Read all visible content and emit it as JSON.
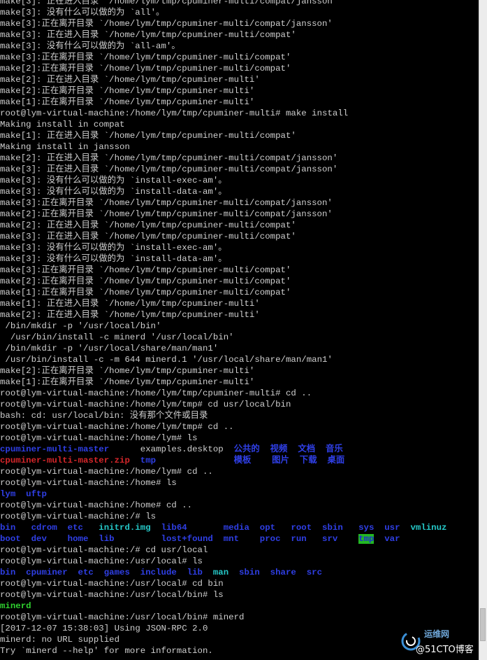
{
  "colors": {
    "background": "#000000",
    "text": "#cfcfcf",
    "directory": "#2f3fe6",
    "archive": "#d6262a",
    "executable": "#2fd12f",
    "symlink": "#25c8c8",
    "sticky_dir_bg": "#23b823"
  },
  "scrollbar": {
    "thumb_position": 0.97,
    "thumb_size": 0.05
  },
  "watermark": {
    "site": "运维网",
    "brand": "@51CTO博客",
    "logo_icon": "swirl-logo-icon"
  },
  "terminal": {
    "lines": [
      [
        {
          "t": "make[3]: 正在进入目录 `/home/lym/tmp/cpuminer-multi/compat/jansson'"
        }
      ],
      [
        {
          "t": "make[3]: 没有什么可以做的为 `all'。"
        }
      ],
      [
        {
          "t": "make[3]:正在离开目录 `/home/lym/tmp/cpuminer-multi/compat/jansson'"
        }
      ],
      [
        {
          "t": "make[3]: 正在进入目录 `/home/lym/tmp/cpuminer-multi/compat'"
        }
      ],
      [
        {
          "t": "make[3]: 没有什么可以做的为 `all-am'。"
        }
      ],
      [
        {
          "t": "make[3]:正在离开目录 `/home/lym/tmp/cpuminer-multi/compat'"
        }
      ],
      [
        {
          "t": "make[2]:正在离开目录 `/home/lym/tmp/cpuminer-multi/compat'"
        }
      ],
      [
        {
          "t": "make[2]: 正在进入目录 `/home/lym/tmp/cpuminer-multi'"
        }
      ],
      [
        {
          "t": "make[2]:正在离开目录 `/home/lym/tmp/cpuminer-multi'"
        }
      ],
      [
        {
          "t": "make[1]:正在离开目录 `/home/lym/tmp/cpuminer-multi'"
        }
      ],
      [
        {
          "t": "root@lym-virtual-machine:/home/lym/tmp/cpuminer-multi# make install"
        }
      ],
      [
        {
          "t": "Making install in compat"
        }
      ],
      [
        {
          "t": "make[1]: 正在进入目录 `/home/lym/tmp/cpuminer-multi/compat'"
        }
      ],
      [
        {
          "t": "Making install in jansson"
        }
      ],
      [
        {
          "t": "make[2]: 正在进入目录 `/home/lym/tmp/cpuminer-multi/compat/jansson'"
        }
      ],
      [
        {
          "t": "make[3]: 正在进入目录 `/home/lym/tmp/cpuminer-multi/compat/jansson'"
        }
      ],
      [
        {
          "t": "make[3]: 没有什么可以做的为 `install-exec-am'。"
        }
      ],
      [
        {
          "t": "make[3]: 没有什么可以做的为 `install-data-am'。"
        }
      ],
      [
        {
          "t": "make[3]:正在离开目录 `/home/lym/tmp/cpuminer-multi/compat/jansson'"
        }
      ],
      [
        {
          "t": "make[2]:正在离开目录 `/home/lym/tmp/cpuminer-multi/compat/jansson'"
        }
      ],
      [
        {
          "t": "make[2]: 正在进入目录 `/home/lym/tmp/cpuminer-multi/compat'"
        }
      ],
      [
        {
          "t": "make[3]: 正在进入目录 `/home/lym/tmp/cpuminer-multi/compat'"
        }
      ],
      [
        {
          "t": "make[3]: 没有什么可以做的为 `install-exec-am'。"
        }
      ],
      [
        {
          "t": "make[3]: 没有什么可以做的为 `install-data-am'。"
        }
      ],
      [
        {
          "t": "make[3]:正在离开目录 `/home/lym/tmp/cpuminer-multi/compat'"
        }
      ],
      [
        {
          "t": "make[2]:正在离开目录 `/home/lym/tmp/cpuminer-multi/compat'"
        }
      ],
      [
        {
          "t": "make[1]:正在离开目录 `/home/lym/tmp/cpuminer-multi/compat'"
        }
      ],
      [
        {
          "t": "make[1]: 正在进入目录 `/home/lym/tmp/cpuminer-multi'"
        }
      ],
      [
        {
          "t": "make[2]: 正在进入目录 `/home/lym/tmp/cpuminer-multi'"
        }
      ],
      [
        {
          "t": " /bin/mkdir -p '/usr/local/bin'"
        }
      ],
      [
        {
          "t": "  /usr/bin/install -c minerd '/usr/local/bin'"
        }
      ],
      [
        {
          "t": " /bin/mkdir -p '/usr/local/share/man/man1'"
        }
      ],
      [
        {
          "t": " /usr/bin/install -c -m 644 minerd.1 '/usr/local/share/man/man1'"
        }
      ],
      [
        {
          "t": "make[2]:正在离开目录 `/home/lym/tmp/cpuminer-multi'"
        }
      ],
      [
        {
          "t": "make[1]:正在离开目录 `/home/lym/tmp/cpuminer-multi'"
        }
      ],
      [
        {
          "t": "root@lym-virtual-machine:/home/lym/tmp/cpuminer-multi# cd .."
        }
      ],
      [
        {
          "t": "root@lym-virtual-machine:/home/lym/tmp# cd usr/local/bin"
        }
      ],
      [
        {
          "t": "bash: cd: usr/local/bin: 没有那个文件或目录"
        }
      ],
      [
        {
          "t": "root@lym-virtual-machine:/home/lym/tmp# cd .."
        }
      ],
      [
        {
          "t": "root@lym-virtual-machine:/home/lym# ls"
        }
      ],
      [
        {
          "t": "cpuminer-multi-master",
          "c": "c-blue"
        },
        {
          "t": "      examples.desktop  "
        },
        {
          "t": "公共的  视频  文档  音乐",
          "c": "c-blue"
        }
      ],
      [
        {
          "t": "cpuminer-multi-master.zip",
          "c": "c-red"
        },
        {
          "t": "  "
        },
        {
          "t": "tmp",
          "c": "c-blue"
        },
        {
          "t": "               "
        },
        {
          "t": "模板    图片  下载  桌面",
          "c": "c-blue"
        }
      ],
      [
        {
          "t": "root@lym-virtual-machine:/home/lym# cd .."
        }
      ],
      [
        {
          "t": "root@lym-virtual-machine:/home# ls"
        }
      ],
      [
        {
          "t": "lym  uftp",
          "c": "c-blue"
        }
      ],
      [
        {
          "t": "root@lym-virtual-machine:/home# cd .."
        }
      ],
      [
        {
          "t": "root@lym-virtual-machine:/# ls"
        }
      ],
      [
        {
          "t": "bin   cdrom  etc   ",
          "c": "c-blue"
        },
        {
          "t": "initrd.img",
          "c": "c-cyan"
        },
        {
          "t": "  "
        },
        {
          "t": "lib64       media  opt   root  sbin   sys  usr  ",
          "c": "c-blue"
        },
        {
          "t": "vmlinuz",
          "c": "c-cyan"
        }
      ],
      [
        {
          "t": "boot  dev    home  lib         lost+found  mnt    proc  run   srv    ",
          "c": "c-blue"
        },
        {
          "t": "tmp",
          "c": "c-tmp"
        },
        {
          "t": "  "
        },
        {
          "t": "var",
          "c": "c-blue"
        }
      ],
      [
        {
          "t": "root@lym-virtual-machine:/# cd usr/local"
        }
      ],
      [
        {
          "t": "root@lym-virtual-machine:/usr/local# ls"
        }
      ],
      [
        {
          "t": "bin  cpuminer  etc  games  include  lib  ",
          "c": "c-blue"
        },
        {
          "t": "man",
          "c": "c-cyan"
        },
        {
          "t": "  "
        },
        {
          "t": "sbin  share  src",
          "c": "c-blue"
        }
      ],
      [
        {
          "t": "root@lym-virtual-machine:/usr/local# cd bin"
        }
      ],
      [
        {
          "t": "root@lym-virtual-machine:/usr/local/bin# ls"
        }
      ],
      [
        {
          "t": "minerd",
          "c": "c-green"
        }
      ],
      [
        {
          "t": "root@lym-virtual-machine:/usr/local/bin# minerd"
        }
      ],
      [
        {
          "t": "[2017-12-07 15:38:03] Using JSON-RPC 2.0"
        }
      ],
      [
        {
          "t": "minerd: no URL supplied"
        }
      ],
      [
        {
          "t": "Try `minerd --help' for more information."
        }
      ]
    ]
  }
}
